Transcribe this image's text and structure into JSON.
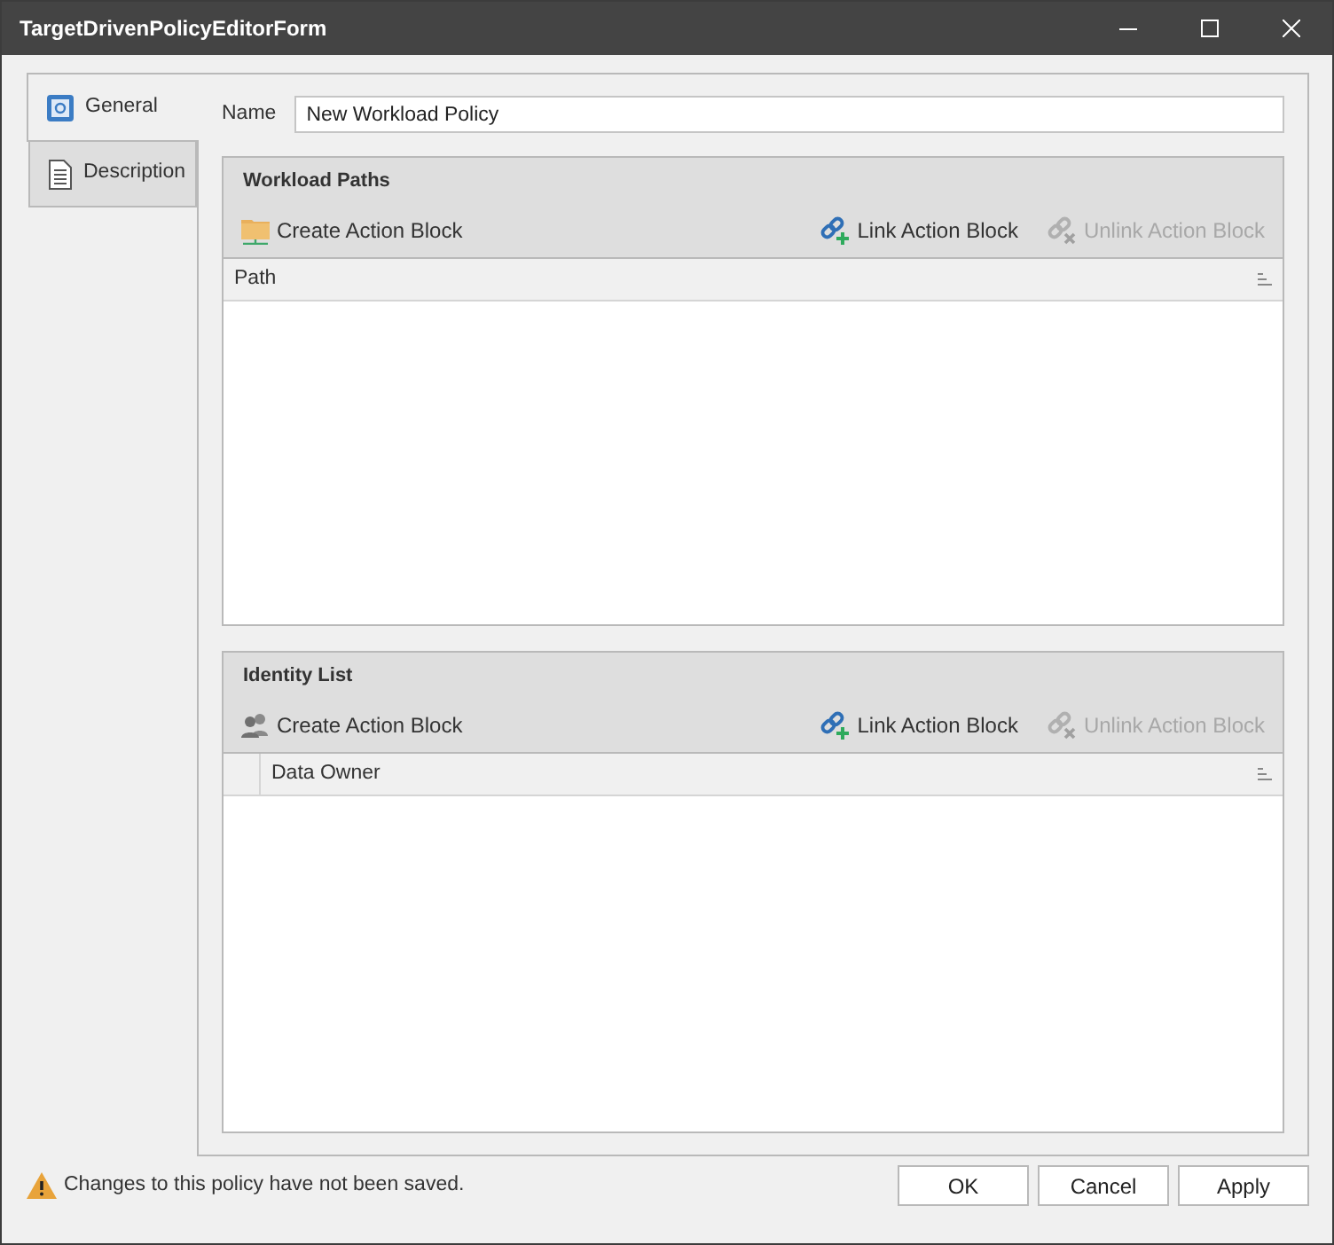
{
  "window": {
    "title": "TargetDrivenPolicyEditorForm"
  },
  "tabs": [
    {
      "label": "General",
      "kind": "safe",
      "selected": true
    },
    {
      "label": "Description",
      "kind": "document",
      "selected": false
    }
  ],
  "name_field": {
    "label": "Name",
    "value": "New Workload Policy"
  },
  "sections": [
    {
      "title": "Workload Paths",
      "toolbar": [
        {
          "label": "Create Action Block",
          "kind": "folder",
          "disabled": false
        },
        {
          "label": "Link Action Block",
          "kind": "link",
          "disabled": false
        },
        {
          "label": "Unlink Action Block",
          "kind": "unlink",
          "disabled": true
        }
      ],
      "grid": {
        "indicator_column": false,
        "columns": [
          "Path"
        ]
      }
    },
    {
      "title": "Identity List",
      "toolbar": [
        {
          "label": "Create Action Block",
          "kind": "people",
          "disabled": false
        },
        {
          "label": "Link Action Block",
          "kind": "link",
          "disabled": false
        },
        {
          "label": "Unlink Action Block",
          "kind": "unlink",
          "disabled": true
        }
      ],
      "grid": {
        "indicator_column": true,
        "columns": [
          "Data Owner"
        ]
      }
    }
  ],
  "status": {
    "message": "Changes to this policy have not been saved."
  },
  "buttons": [
    "OK",
    "Cancel",
    "Apply"
  ]
}
